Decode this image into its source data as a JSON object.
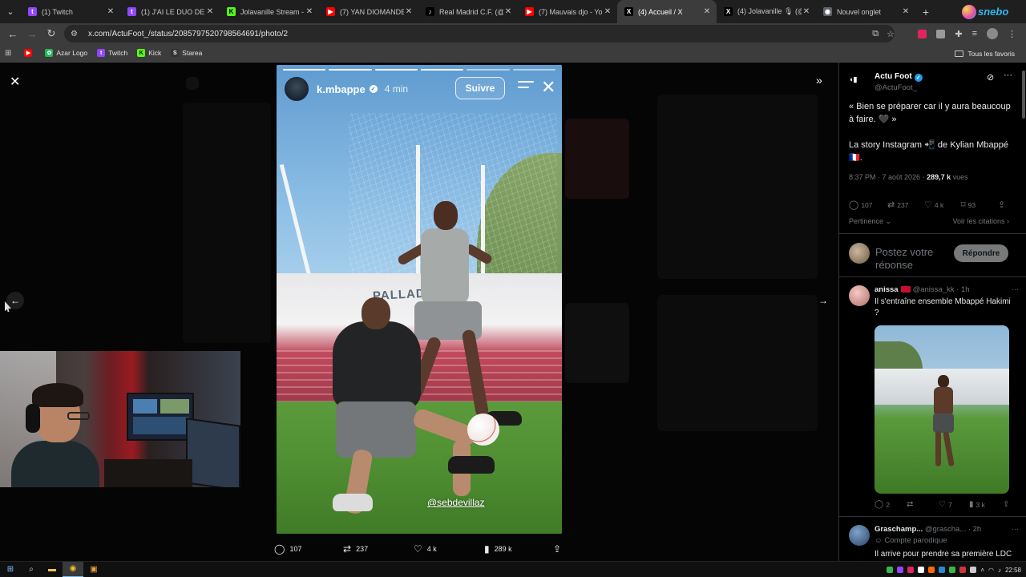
{
  "browser": {
    "tabs": [
      {
        "title": "(1) Twitch",
        "favicon_color": "#9146ff",
        "glyph": "t"
      },
      {
        "title": "(1) J'AI LE DUO DE L'",
        "favicon_color": "#9146ff",
        "glyph": "t"
      },
      {
        "title": "Jolavanille Stream - V",
        "favicon_color": "#53fc18",
        "glyph": "K"
      },
      {
        "title": "(7) YAN DIOMANDE |",
        "favicon_color": "#ff0000",
        "glyph": "▶"
      },
      {
        "title": "Real Madrid C.F. (@re",
        "favicon_color": "#000000",
        "glyph": "♪"
      },
      {
        "title": "(7) Mauvais djo - You",
        "favicon_color": "#ff0000",
        "glyph": "▶"
      },
      {
        "title": "(4) Accueil / X",
        "favicon_color": "#000000",
        "glyph": "X",
        "active": true
      },
      {
        "title": "(4) Jolavanille 🎙 (@J",
        "favicon_color": "#000000",
        "glyph": "X"
      },
      {
        "title": "Nouvel onglet",
        "favicon_color": "#5f6368",
        "glyph": "◉"
      }
    ],
    "url": "x.com/ActuFoot_/status/2085797520798564691/photo/2",
    "bookmarks": [
      {
        "label": "",
        "color": "#ff0000",
        "glyph": "▶"
      },
      {
        "label": "Azar Logo",
        "color": "#1db954",
        "glyph": "✿"
      },
      {
        "label": "Twitch",
        "color": "#9146ff",
        "glyph": "t"
      },
      {
        "label": "Kick",
        "color": "#53fc18",
        "glyph": "K"
      },
      {
        "label": "Starea",
        "color": "#333333",
        "glyph": "S"
      }
    ],
    "all_bookmarks": "Tous les favoris"
  },
  "story": {
    "username": "k.mbappe",
    "time": "4 min",
    "follow": "Suivre",
    "sign": "PALLADIO",
    "tag": "@sebdevillaz",
    "progress_segments": 6,
    "progress_done": 4
  },
  "media_actions": {
    "replies": "107",
    "reposts": "237",
    "likes": "4 k",
    "views": "289 k"
  },
  "post": {
    "name": "Actu Foot",
    "handle": "@ActuFoot_",
    "text1": "« Bien se préparer car il y aura beaucoup à faire. 🖤 »",
    "text2": "La story Instagram 📲 de Kylian Mbappé 🇫🇷.",
    "date": "8:37 PM · 7 août 2026 · ",
    "views_value": "289,7 k",
    "views_label": " vues",
    "stats": {
      "replies": "107",
      "reposts": "237",
      "likes": "4 k",
      "bookmarks": "93"
    },
    "sort": "Pertinence",
    "quotes": "Voir les citations"
  },
  "reply_box": {
    "placeholder": "Postez votre réponse",
    "button": "Répondre"
  },
  "replies": [
    {
      "name": "anissa",
      "handle": "@anissa_kk",
      "time": "· 1h",
      "text": "Il s'entraîne ensemble Mbappé Hakimi ?",
      "stats": {
        "replies": "2",
        "reposts": "",
        "likes": "7",
        "views": "3 k"
      }
    },
    {
      "name": "Graschamp...",
      "handle": "@grascha...",
      "time": "· 2h",
      "parody": "Compte parodique",
      "text": "Il arrive pour prendre sa première LDC"
    }
  ],
  "taskbar": {
    "time": "22:58"
  }
}
